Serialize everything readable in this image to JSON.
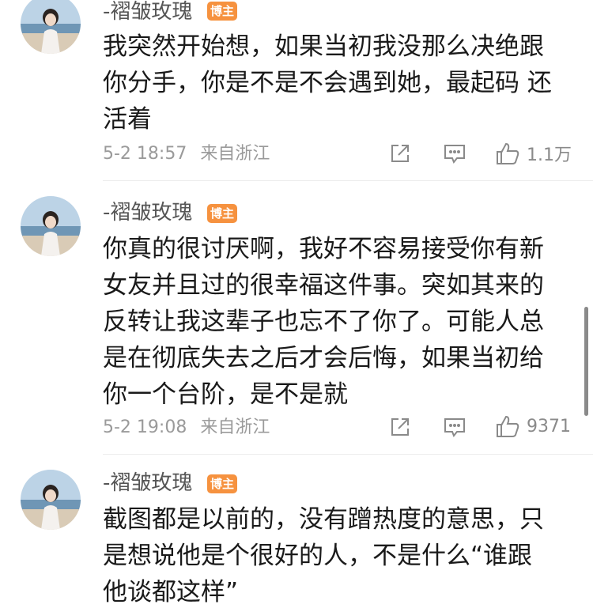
{
  "comments": [
    {
      "username": "-褶皱玫瑰",
      "badge": "博主",
      "text": "我突然开始想，如果当初我没那么决绝跟\n你分手，你是不是不会遇到她，最起码 还\n活着",
      "date": "5-2 18:57",
      "location": "来自浙江",
      "likes": "1.1万"
    },
    {
      "username": "-褶皱玫瑰",
      "badge": "博主",
      "text": "你真的很讨厌啊，我好不容易接受你有新\n女友并且过的很幸福这件事。突如其来的\n反转让我这辈子也忘不了你了。可能人总\n是在彻底失去之后才会后悔，如果当初给\n你一个台阶，是不是就",
      "date": "5-2 19:08",
      "location": "来自浙江",
      "likes": "9371"
    },
    {
      "username": "-褶皱玫瑰",
      "badge": "博主",
      "text": "截图都是以前的，没有蹭热度的意思，只\n是想说他是个很好的人，不是什么“谁跟\n他谈都这样”"
    }
  ],
  "icons": {
    "share": "share-icon",
    "comment": "comment-icon",
    "like": "thumbs-up-icon"
  },
  "colors": {
    "badge": "#f6923f",
    "text": "#1a1a1a",
    "meta": "#9a9a9a"
  }
}
